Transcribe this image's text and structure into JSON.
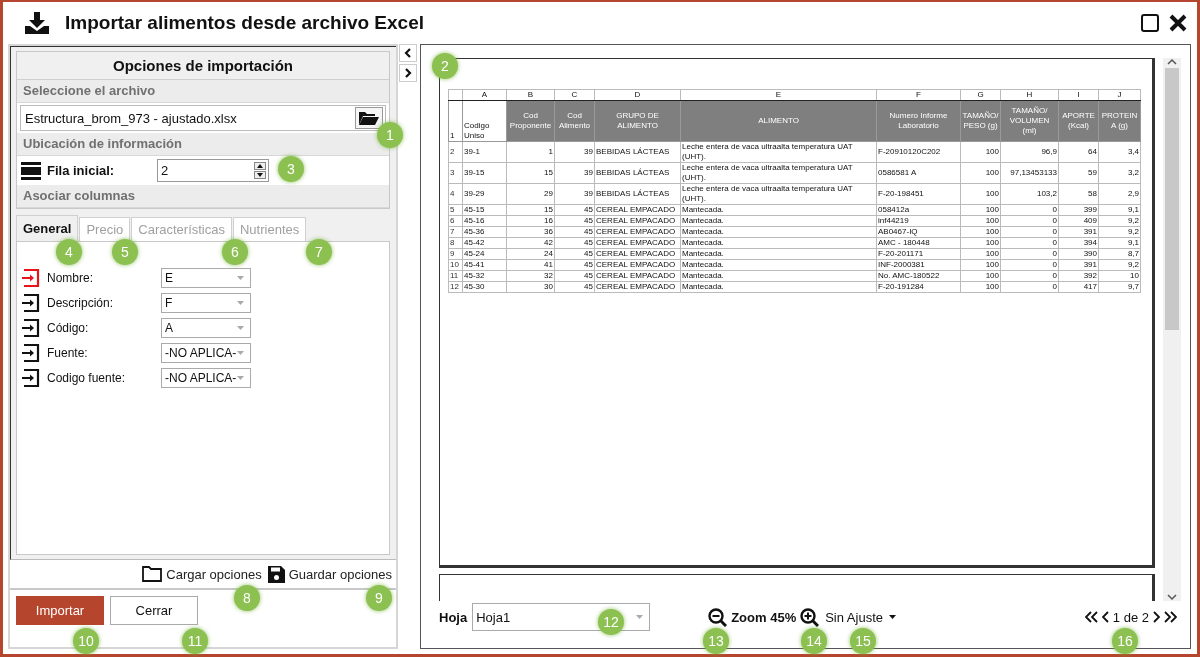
{
  "window": {
    "title": "Importar alimentos desde archivo Excel"
  },
  "options_panel": {
    "title": "Opciones de importación",
    "file_section": "Seleccione el archivo",
    "file": {
      "value": "Estructura_brom_973 - ajustado.xlsx"
    },
    "location_section": "Ubicación de información",
    "start_row": {
      "label": "Fila inicial:",
      "value": "2"
    },
    "columns_section": "Asociar columnas",
    "tabs": [
      {
        "label": "General",
        "selected": true
      },
      {
        "label": "Precio",
        "selected": false
      },
      {
        "label": "Características",
        "selected": false
      },
      {
        "label": "Nutrientes",
        "selected": false
      }
    ],
    "mappings": [
      {
        "label": "Nombre:",
        "value": "E",
        "highlighted": true
      },
      {
        "label": "Descripción:",
        "value": "F",
        "highlighted": false
      },
      {
        "label": "Código:",
        "value": "A",
        "highlighted": false
      },
      {
        "label": "Fuente:",
        "value": "-NO APLICA-",
        "highlighted": false
      },
      {
        "label": "Codigo fuente:",
        "value": "-NO APLICA-",
        "highlighted": false
      }
    ],
    "load_options": "Cargar opciones",
    "save_options": "Guardar opciones",
    "buttons": [
      {
        "label": "Importar",
        "kind": "primary"
      },
      {
        "label": "Cerrar",
        "kind": "secondary"
      }
    ]
  },
  "preview": {
    "sheet": {
      "column_letters": [
        "A",
        "B",
        "C",
        "D",
        "E",
        "F",
        "G",
        "H",
        "I",
        "J"
      ],
      "header": {
        "number": "1",
        "cells": [
          "Codigo Uniso",
          "Cod Proponente",
          "Cod Alimento",
          "GRUPO DE ALIMENTO",
          "ALIMENTO",
          "Numero Informe Laboratorio",
          "TAMAÑO/ PESO (g)",
          "TAMAÑO/ VOLUMEN (ml)",
          "APORTE (Kcal)",
          "PROTEINA (g)"
        ]
      },
      "rows": [
        {
          "number": "2",
          "cells": [
            "39-1",
            "1",
            "39",
            "BEBIDAS LÁCTEAS",
            "Leche entera de vaca ultraalta temperatura UAT (UHT).",
            "F-20910120C202",
            "100",
            "96,9",
            "64",
            "3,4"
          ]
        },
        {
          "number": "3",
          "cells": [
            "39-15",
            "15",
            "39",
            "BEBIDAS LÁCTEAS",
            "Leche entera de vaca ultraalta temperatura UAT (UHT).",
            "0586581 A",
            "100",
            "97,13453133",
            "59",
            "3,2"
          ]
        },
        {
          "number": "4",
          "cells": [
            "39-29",
            "29",
            "39",
            "BEBIDAS LÁCTEAS",
            "Leche entera de vaca ultraalta temperatura UAT (UHT).",
            "F-20-198451",
            "100",
            "103,2",
            "58",
            "2,9"
          ]
        },
        {
          "number": "5",
          "cells": [
            "45-15",
            "15",
            "45",
            "CEREAL EMPACADO",
            "Mantecada.",
            "058412a",
            "100",
            "0",
            "399",
            "9,1"
          ]
        },
        {
          "number": "6",
          "cells": [
            "45-16",
            "16",
            "45",
            "CEREAL EMPACADO",
            "Mantecada.",
            "inf44219",
            "100",
            "0",
            "409",
            "9,2"
          ]
        },
        {
          "number": "7",
          "cells": [
            "45-36",
            "36",
            "45",
            "CEREAL EMPACADO",
            "Mantecada.",
            "AB0467-IQ",
            "100",
            "0",
            "391",
            "9,2"
          ]
        },
        {
          "number": "8",
          "cells": [
            "45-42",
            "42",
            "45",
            "CEREAL EMPACADO",
            "Mantecada.",
            "AMC - 180448",
            "100",
            "0",
            "394",
            "9,1"
          ]
        },
        {
          "number": "9",
          "cells": [
            "45-24",
            "24",
            "45",
            "CEREAL EMPACADO",
            "Mantecada.",
            "F-20-201171",
            "100",
            "0",
            "390",
            "8,7"
          ]
        },
        {
          "number": "10",
          "cells": [
            "45-41",
            "41",
            "45",
            "CEREAL EMPACADO",
            "Mantecada.",
            "INF-2000381",
            "100",
            "0",
            "391",
            "9,2"
          ]
        },
        {
          "number": "11",
          "cells": [
            "45-32",
            "32",
            "45",
            "CEREAL EMPACADO",
            "Mantecada.",
            "No. AMC-180522",
            "100",
            "0",
            "392",
            "10"
          ]
        },
        {
          "number": "12",
          "cells": [
            "45-30",
            "30",
            "45",
            "CEREAL EMPACADO",
            "Mantecada.",
            "F-20-191284",
            "100",
            "0",
            "417",
            "9,7"
          ]
        }
      ]
    },
    "sheet_label": "Hoja",
    "sheet_value": "Hoja1",
    "zoom": "Zoom 45%",
    "fit": "Sin Ajuste",
    "page": "1 de 2"
  },
  "callouts": [
    "1",
    "2",
    "3",
    "4",
    "5",
    "6",
    "7",
    "8",
    "9",
    "10",
    "11",
    "12",
    "13",
    "14",
    "15",
    "16"
  ]
}
